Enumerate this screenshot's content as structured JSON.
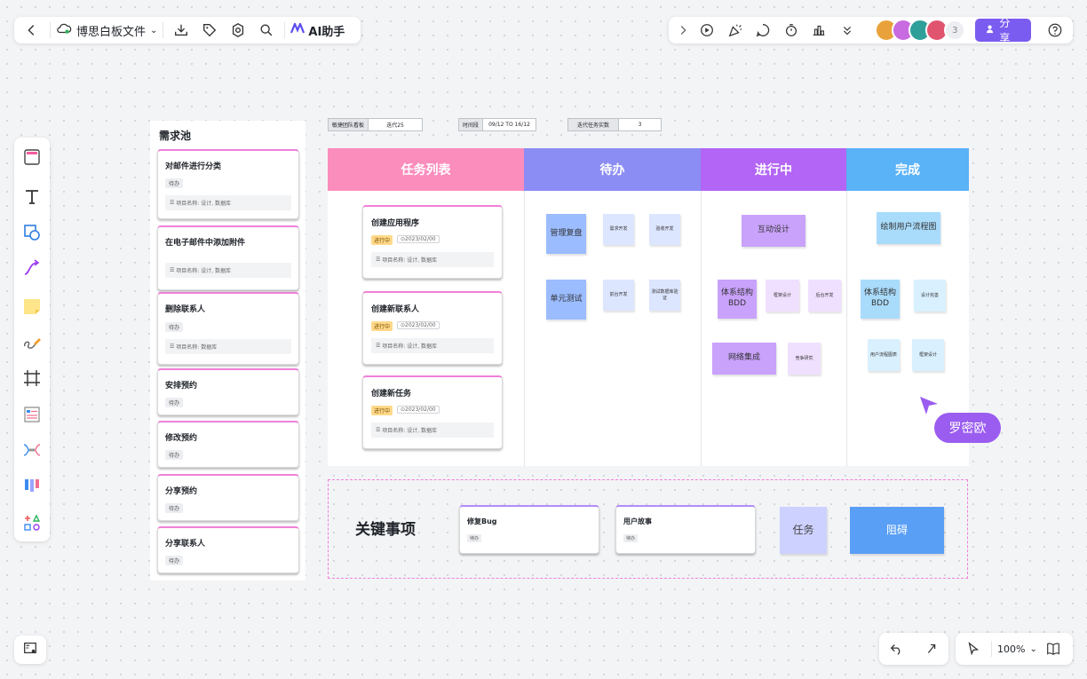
{
  "topbar": {
    "file_name": "博思白板文件",
    "ai_label": "AI助手"
  },
  "collab": {
    "count": "3",
    "share_label": "分享"
  },
  "zoom": {
    "level": "100%"
  },
  "pool": {
    "title": "需求池",
    "cards": [
      {
        "title": "对邮件进行分类",
        "tag": "待办",
        "meta": "项目名称: 设计, 数据库"
      },
      {
        "title": "在电子邮件中添加附件",
        "tag": "",
        "meta": "项目名称: 设计, 数据库"
      },
      {
        "title": "删除联系人",
        "tag": "待办",
        "meta": "项目名称: 数据库"
      },
      {
        "title": "安排预约",
        "tag": "待办",
        "meta": ""
      },
      {
        "title": "修改预约",
        "tag": "待办",
        "meta": ""
      },
      {
        "title": "分享预约",
        "tag": "待办",
        "meta": ""
      },
      {
        "title": "分享联系人",
        "tag": "待办",
        "meta": ""
      }
    ]
  },
  "info": {
    "team_label": "敏捷团队看板",
    "team_value": "迭代25",
    "time_label": "时间段",
    "time_value": "09/12 TO 16/12",
    "cap_label": "迭代任务实数",
    "cap_value": "3"
  },
  "columns": {
    "list": "任务列表",
    "todo": "待办",
    "doing": "进行中",
    "done": "完成"
  },
  "colors": {
    "list": "#fb8dbd",
    "todo": "#8c8cf5",
    "doing": "#b365f5",
    "done": "#5ab2f7",
    "accent": "#7b5cf0"
  },
  "tasks": [
    {
      "title": "创建应用程序",
      "status": "进行中",
      "date": "⊙2023/02/00",
      "meta": "项目名称: 设计, 数据库"
    },
    {
      "title": "创建新联系人",
      "status": "进行中",
      "date": "⊙2023/02/00",
      "meta": "项目名称: 设计, 数据库"
    },
    {
      "title": "创建新任务",
      "status": "进行中",
      "date": "⊙2023/02/00",
      "meta": "项目名称: 设计, 数据库"
    }
  ],
  "stickies": {
    "todo": [
      "管理复盘",
      "需求开发",
      "验收开发",
      "单元测试",
      "前台开发",
      "测试数据库验证"
    ],
    "doing": [
      "互动设计",
      "体系结构BDD",
      "框架设计",
      "后台开发",
      "网络集成",
      "竞争研究"
    ],
    "done": [
      "绘制用户流程图",
      "体系结构BDD",
      "设计完善",
      "用户流程图表",
      "框架设计"
    ]
  },
  "keyitems": {
    "title": "关键事项",
    "card1_title": "修复Bug",
    "card1_tag": "待办",
    "card2_title": "用户故事",
    "card2_tag": "待办",
    "task_label": "任务",
    "block_label": "阻碍"
  },
  "cursor_user": "罗密欧"
}
